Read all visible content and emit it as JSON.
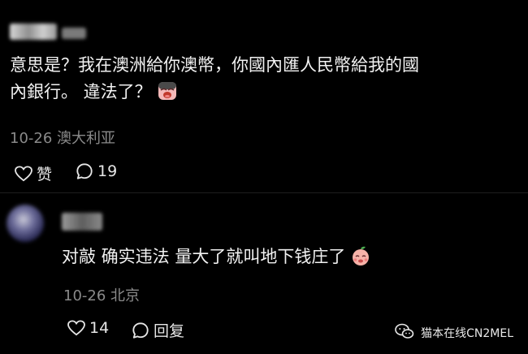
{
  "comment1": {
    "text_line1": "意思是？我在澳洲給你澳幣，你國內匯人民幣給我的國",
    "text_line2": "內銀行。 違法了？",
    "emoji": "crying-face-emoji",
    "date": "10-26",
    "location": "澳大利亚",
    "like_label": "赞",
    "reply_count": "19"
  },
  "comment2": {
    "text": "对敲 确实违法 量大了就叫地下钱庄了",
    "emoji": "peach-face-emoji",
    "date": "10-26",
    "location": "北京",
    "like_count": "14",
    "reply_label": "回复"
  },
  "watermark": {
    "text": "猫本在线CN2MEL",
    "icon": "wechat-icon"
  },
  "colors": {
    "background": "#000000",
    "text": "#f2f2f2",
    "meta": "#8a8a8a"
  }
}
